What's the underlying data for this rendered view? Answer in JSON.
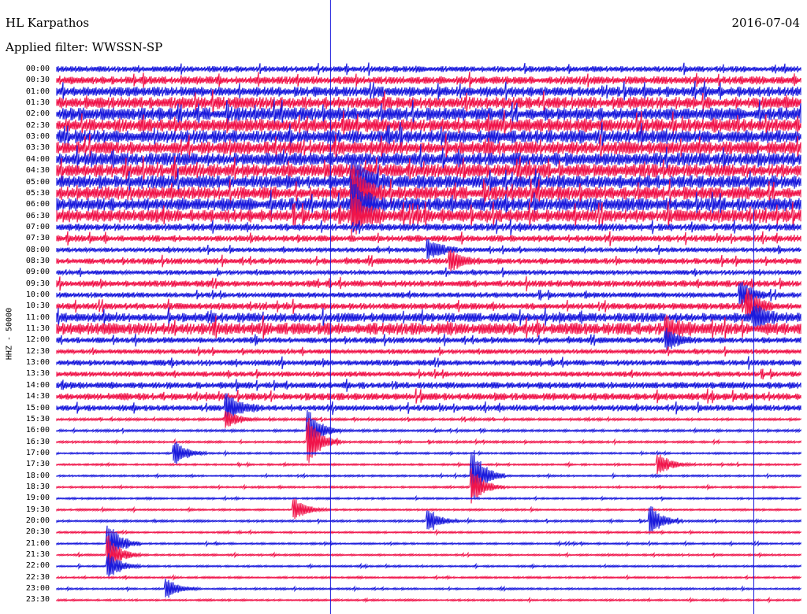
{
  "header": {
    "station": "HL Karpathos",
    "filter": "Applied filter: WWSSN-SP",
    "date": "2016-07-04"
  },
  "channel_label": "HHZ - 50000",
  "colors": {
    "blue": "#1a1adc",
    "red": "#f0144a",
    "background": "#ffffff"
  },
  "chart_data": {
    "type": "line",
    "subtype": "helicorder",
    "title": "HL Karpathos",
    "ylabel": "HHZ - 50000",
    "row_labels": [
      "00:00",
      "00:30",
      "01:00",
      "01:30",
      "02:00",
      "02:30",
      "03:00",
      "03:30",
      "04:00",
      "04:30",
      "05:00",
      "05:30",
      "06:00",
      "06:30",
      "07:00",
      "07:30",
      "08:00",
      "08:30",
      "09:00",
      "09:30",
      "10:00",
      "10:30",
      "11:00",
      "11:30",
      "12:00",
      "12:30",
      "13:00",
      "13:30",
      "14:00",
      "14:30",
      "15:00",
      "15:30",
      "16:00",
      "16:30",
      "17:00",
      "17:30",
      "18:00",
      "18:30",
      "19:00",
      "19:30",
      "20:00",
      "20:30",
      "21:00",
      "21:30",
      "22:00",
      "22:30",
      "23:00",
      "23:30"
    ],
    "row_colors": [
      "blue",
      "red"
    ],
    "row_noise": [
      0.45,
      0.6,
      0.75,
      0.9,
      1.0,
      1.0,
      1.0,
      1.0,
      1.0,
      1.0,
      1.0,
      1.0,
      1.0,
      0.95,
      0.55,
      0.5,
      0.35,
      0.45,
      0.35,
      0.5,
      0.4,
      0.5,
      0.7,
      0.9,
      0.45,
      0.35,
      0.45,
      0.4,
      0.5,
      0.55,
      0.45,
      0.18,
      0.18,
      0.16,
      0.14,
      0.14,
      0.14,
      0.14,
      0.14,
      0.14,
      0.16,
      0.14,
      0.14,
      0.14,
      0.14,
      0.14,
      0.14,
      0.14
    ],
    "events": [
      {
        "row": 10,
        "position": 0.4,
        "amplitude": 2.6
      },
      {
        "row": 11,
        "position": 0.4,
        "amplitude": 2.8
      },
      {
        "row": 12,
        "position": 0.4,
        "amplitude": 2.4
      },
      {
        "row": 13,
        "position": 0.4,
        "amplitude": 2.2
      },
      {
        "row": 16,
        "position": 0.5,
        "amplitude": 1.3
      },
      {
        "row": 17,
        "position": 0.53,
        "amplitude": 1.2
      },
      {
        "row": 20,
        "position": 0.92,
        "amplitude": 1.4
      },
      {
        "row": 21,
        "position": 0.93,
        "amplitude": 1.6
      },
      {
        "row": 22,
        "position": 0.94,
        "amplitude": 1.3
      },
      {
        "row": 23,
        "position": 0.82,
        "amplitude": 1.1
      },
      {
        "row": 24,
        "position": 0.82,
        "amplitude": 1.2
      },
      {
        "row": 30,
        "position": 0.23,
        "amplitude": 1.5
      },
      {
        "row": 31,
        "position": 0.23,
        "amplitude": 1.0
      },
      {
        "row": 32,
        "position": 0.34,
        "amplitude": 2.2
      },
      {
        "row": 33,
        "position": 0.34,
        "amplitude": 2.6
      },
      {
        "row": 34,
        "position": 0.16,
        "amplitude": 1.3
      },
      {
        "row": 35,
        "position": 0.81,
        "amplitude": 1.2
      },
      {
        "row": 36,
        "position": 0.56,
        "amplitude": 3.0
      },
      {
        "row": 37,
        "position": 0.56,
        "amplitude": 2.0
      },
      {
        "row": 39,
        "position": 0.32,
        "amplitude": 1.2
      },
      {
        "row": 40,
        "position": 0.5,
        "amplitude": 1.3
      },
      {
        "row": 40,
        "position": 0.8,
        "amplitude": 1.5
      },
      {
        "row": 42,
        "position": 0.07,
        "amplitude": 2.4
      },
      {
        "row": 43,
        "position": 0.07,
        "amplitude": 2.0
      },
      {
        "row": 44,
        "position": 0.07,
        "amplitude": 1.5
      },
      {
        "row": 46,
        "position": 0.15,
        "amplitude": 1.1
      }
    ],
    "time_markers": [
      0.368,
      0.937
    ],
    "grid": false,
    "legend": "none"
  }
}
